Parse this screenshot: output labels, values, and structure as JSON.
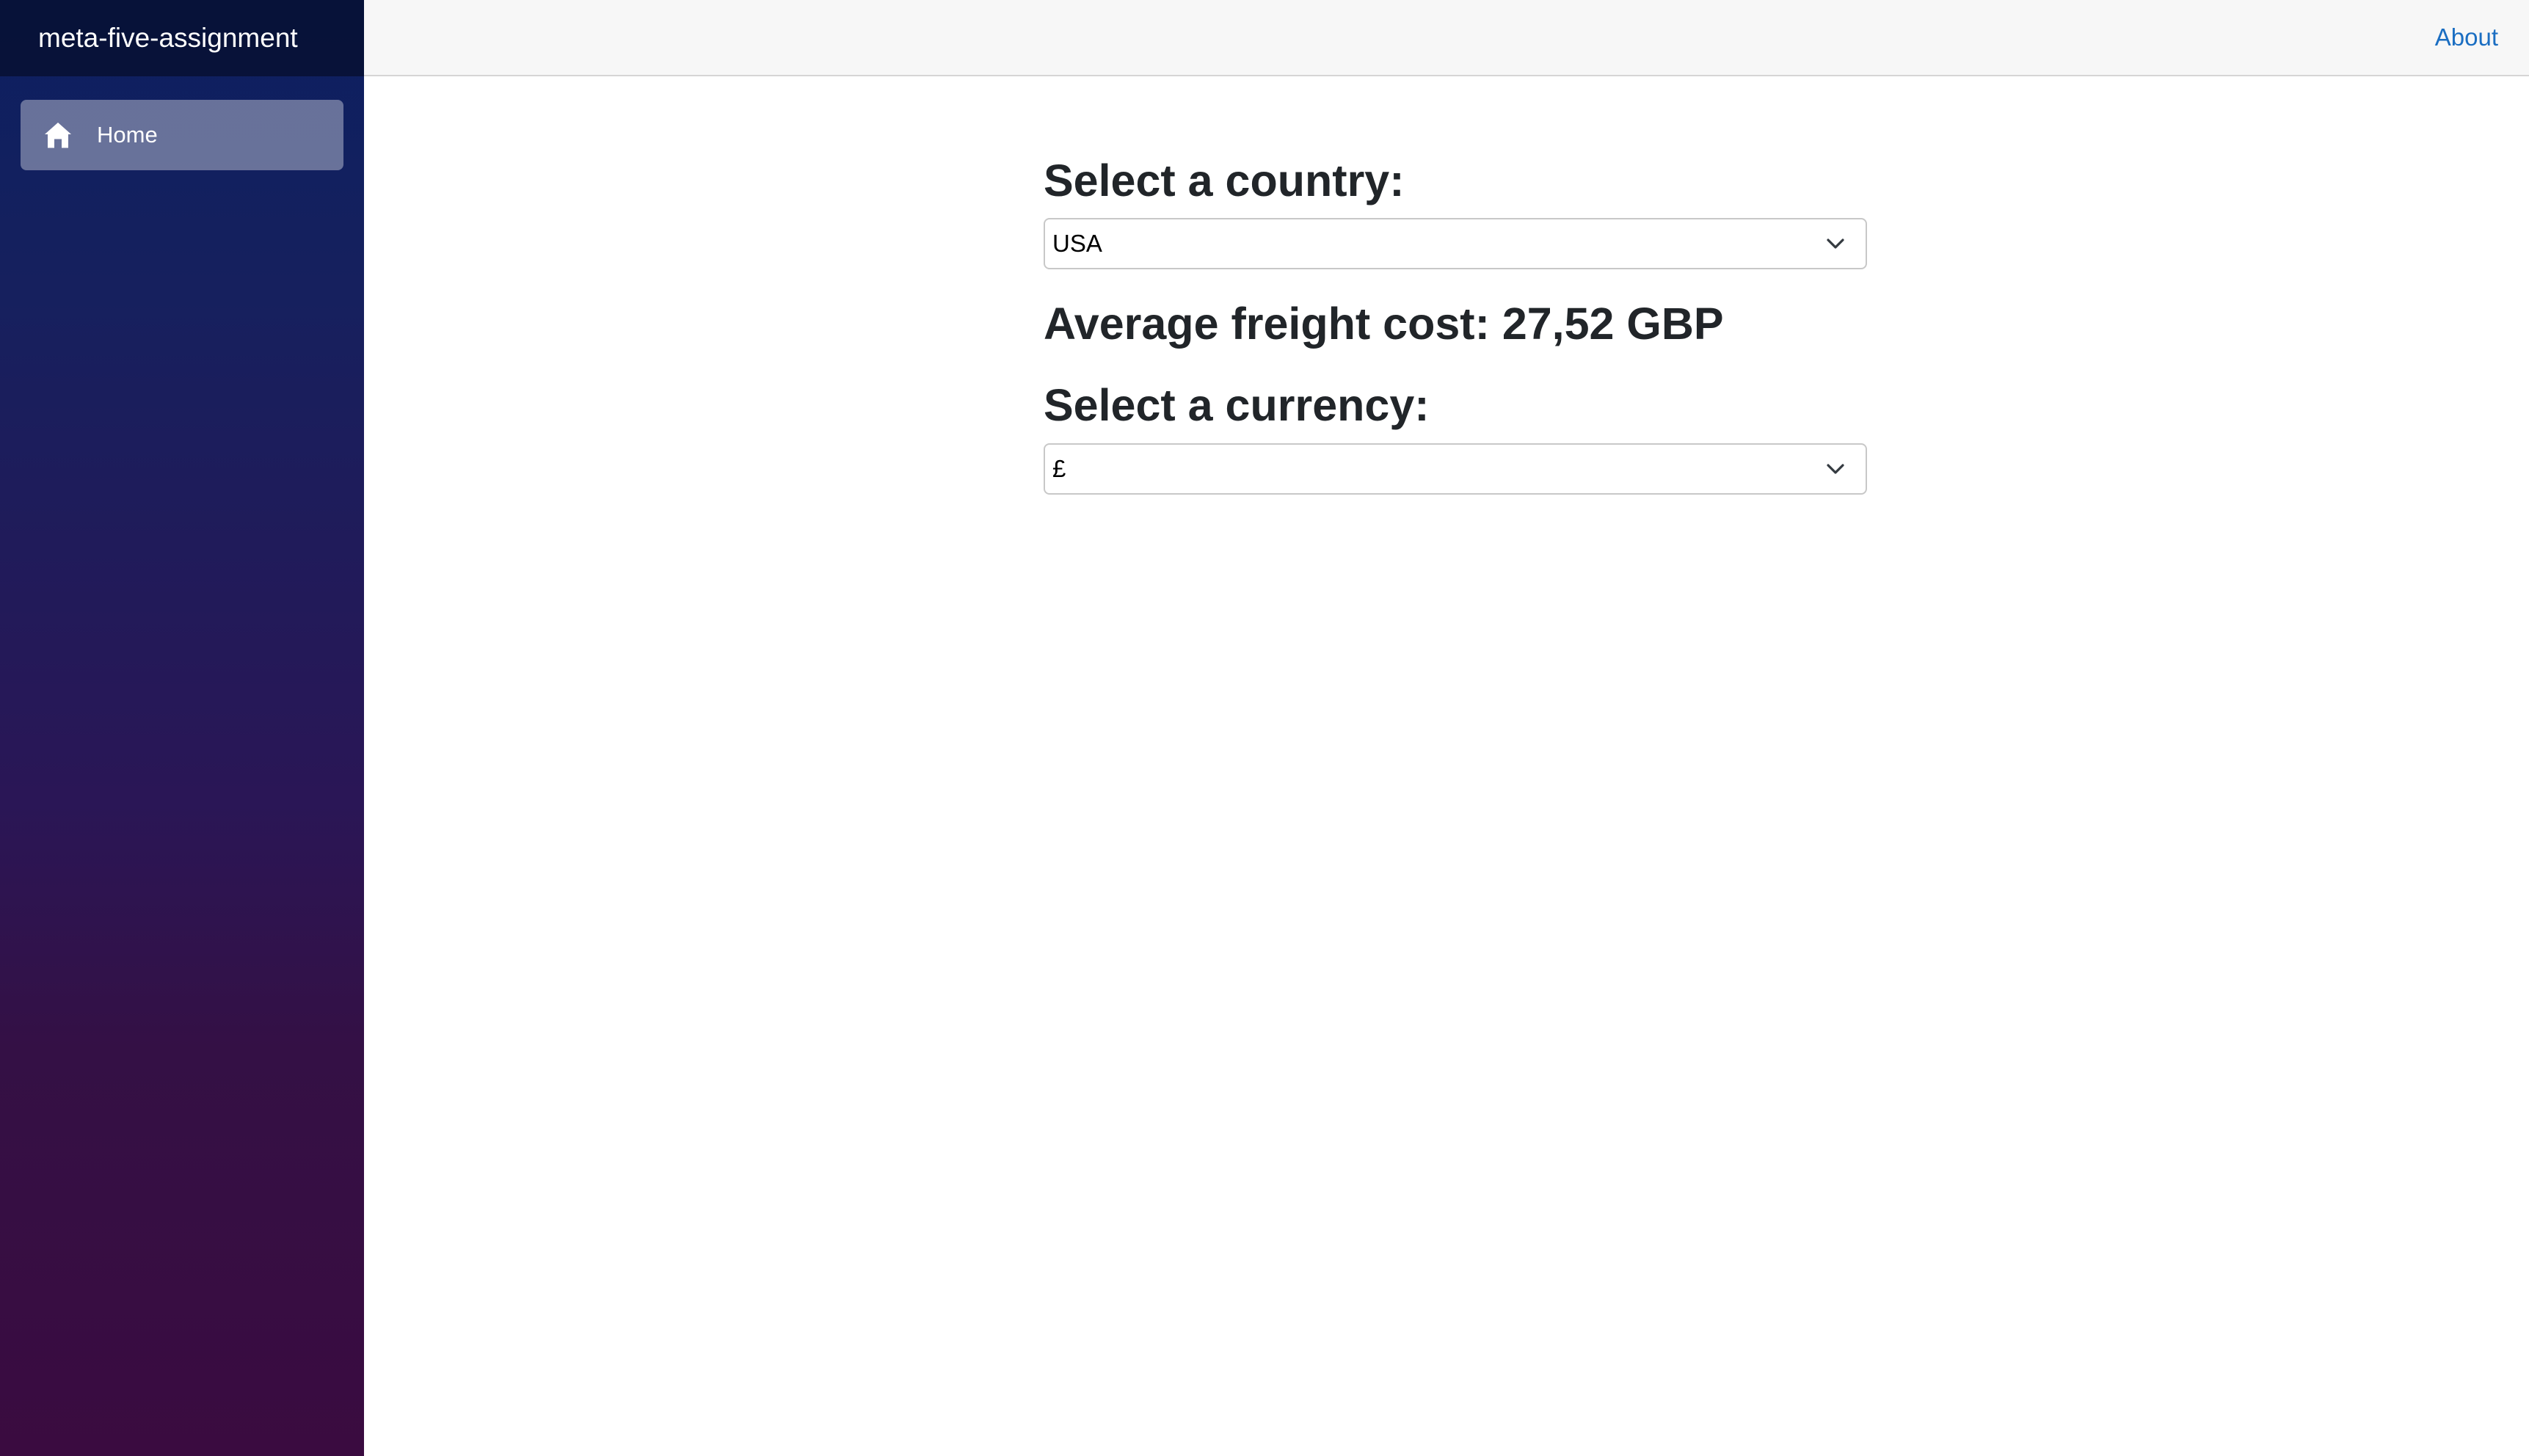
{
  "sidebar": {
    "brand": "meta-five-assignment",
    "items": [
      {
        "label": "Home",
        "icon": "home-icon",
        "active": true
      }
    ]
  },
  "topbar": {
    "about_label": "About"
  },
  "main": {
    "country_heading": "Select a country:",
    "country_value": "USA",
    "freight_text": "Average freight cost: 27,52 GBP",
    "currency_heading": "Select a currency:",
    "currency_value": "£"
  },
  "colors": {
    "sidebar_gradient_top": "#0c1f60",
    "sidebar_gradient_bottom": "#3a0b40",
    "link": "#1b6ec2",
    "heading_text": "#212529",
    "topbar_bg": "#f7f7f7"
  }
}
